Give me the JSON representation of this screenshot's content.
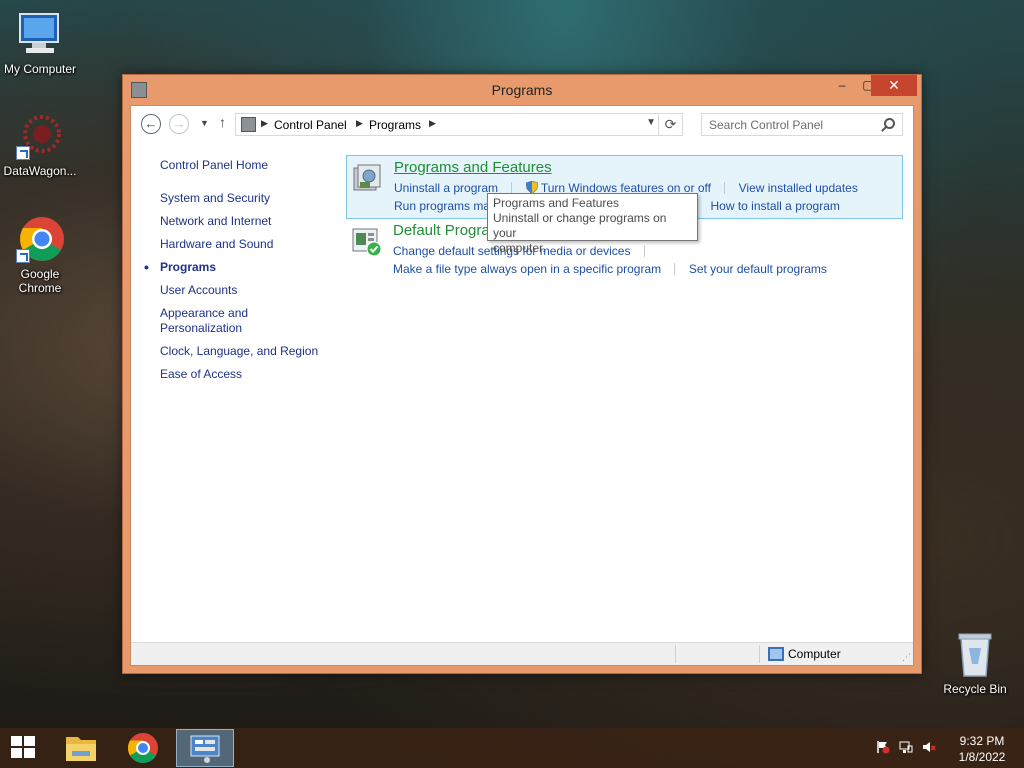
{
  "desktop": {
    "icons": [
      {
        "label": "My Computer"
      },
      {
        "label": "DataWagon..."
      },
      {
        "label": "Google Chrome"
      },
      {
        "label": "Recycle Bin"
      }
    ]
  },
  "window": {
    "title": "Programs",
    "controls": {
      "minimize": "–",
      "maximize": "▢",
      "close": "✕"
    }
  },
  "address": {
    "crumbs": [
      "Control Panel",
      "Programs"
    ],
    "search_placeholder": "Search Control Panel"
  },
  "sidebar": {
    "items": [
      {
        "label": "Control Panel Home"
      },
      {
        "label": "System and Security"
      },
      {
        "label": "Network and Internet"
      },
      {
        "label": "Hardware and Sound"
      },
      {
        "label": "Programs",
        "active": true
      },
      {
        "label": "User Accounts"
      },
      {
        "label": "Appearance and"
      },
      {
        "label": "Personalization"
      },
      {
        "label": "Clock, Language, and Region"
      },
      {
        "label": "Ease of Access"
      }
    ]
  },
  "categories": [
    {
      "title": "Programs and Features",
      "links_row1": [
        "Uninstall a program",
        "Turn Windows features on or off",
        "View installed updates"
      ],
      "links_row2": [
        "Run programs made for previous versions of Windows",
        "How to install a program"
      ]
    },
    {
      "title": "Default Programs",
      "links_row1": [
        "Change default settings for media or devices"
      ],
      "links_row2": [
        "Make a file type always open in a specific program",
        "Set your default programs"
      ]
    }
  ],
  "tooltip": {
    "title": "Programs and Features",
    "line1": "Uninstall or change programs on your",
    "line2": "computer."
  },
  "statusbar": {
    "location": "Computer"
  },
  "taskbar": {
    "time": "9:32 PM",
    "date": "1/8/2022",
    "pinned": [
      "File Explorer",
      "Google Chrome",
      "Control Panel"
    ]
  },
  "colors": {
    "window_frame": "#e79a6c",
    "close_button": "#c7452f",
    "category_title": "#1f8e35",
    "link": "#1e4fa8",
    "sidebar_link": "#1e3287"
  }
}
